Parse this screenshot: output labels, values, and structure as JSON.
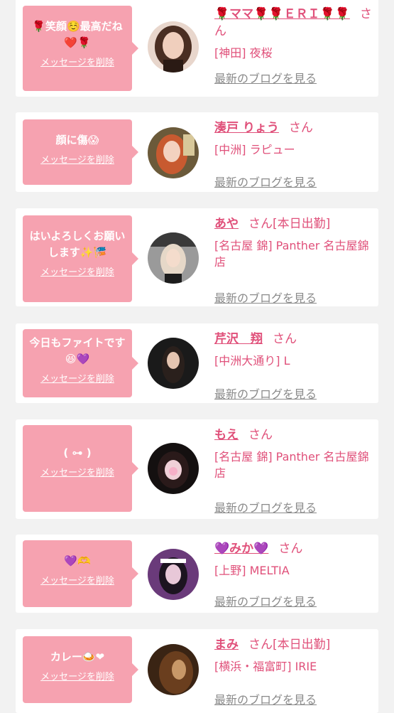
{
  "messages": [
    {
      "message": "🌹笑顔☺️最高だね❤️🌹",
      "delete_label": "メッセージを削除",
      "name": "🌹ママ🌹🌹ＥＲＩ🌹🌹",
      "honorific": "さん",
      "status": "",
      "shop": "[神田] 夜桜",
      "blog_label": "最新のブログを見る",
      "avatar_icon": "profile-photo"
    },
    {
      "message": "顔に傷😱",
      "delete_label": "メッセージを削除",
      "name": "湊戸 りょう",
      "honorific": "さん",
      "status": "",
      "shop": "[中洲] ラピュー",
      "blog_label": "最新のブログを見る",
      "avatar_icon": "profile-photo"
    },
    {
      "message": "はいよろしくお願いします✨🎏",
      "delete_label": "メッセージを削除",
      "name": "あや",
      "honorific": "さん",
      "status": "[本日出勤]",
      "shop": "[名古屋 錦] Panther 名古屋錦店",
      "blog_label": "最新のブログを見る",
      "avatar_icon": "profile-photo"
    },
    {
      "message": "今日もファイトです😆💜",
      "delete_label": "メッセージを削除",
      "name": "芹沢　翔",
      "honorific": "さん",
      "status": "",
      "shop": "[中洲大通り] L",
      "blog_label": "最新のブログを見る",
      "avatar_icon": "profile-photo"
    },
    {
      "message": "( ⊶ )",
      "delete_label": "メッセージを削除",
      "name": "もえ",
      "honorific": "さん",
      "status": "",
      "shop": "[名古屋 錦] Panther 名古屋錦店",
      "blog_label": "最新のブログを見る",
      "avatar_icon": "profile-photo"
    },
    {
      "message": "💜🫶",
      "delete_label": "メッセージを削除",
      "name": "💜みか💜",
      "honorific": "さん",
      "status": "",
      "shop": "[上野] MELTIA",
      "blog_label": "最新のブログを見る",
      "avatar_icon": "profile-photo"
    },
    {
      "message": "カレー🍛❤",
      "delete_label": "メッセージを削除",
      "name": "まみ",
      "honorific": "さん",
      "status": "[本日出勤]",
      "shop": "[横浜・福富町] IRIE",
      "blog_label": "最新のブログを見る",
      "avatar_icon": "profile-photo"
    }
  ],
  "colors": {
    "accent": "#e0507a",
    "bubble": "#f6a2b0",
    "muted": "#8a8a8a",
    "background": "#f2f2f2"
  }
}
